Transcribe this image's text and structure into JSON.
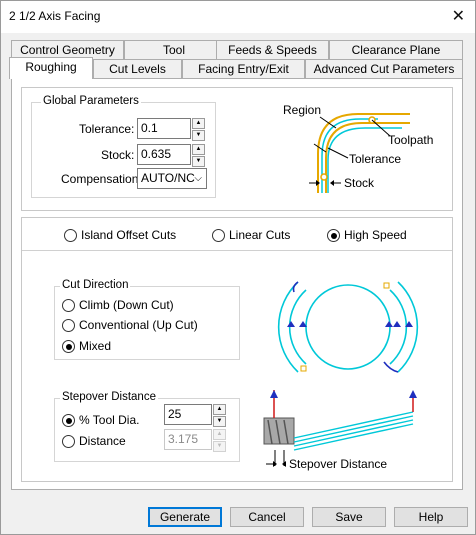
{
  "window": {
    "title": "2 1/2 Axis Facing",
    "close_glyph": "✕"
  },
  "tabs": {
    "row1": [
      "Control Geometry",
      "Tool",
      "Feeds & Speeds",
      "Clearance Plane"
    ],
    "row2": [
      "Roughing",
      "Cut Levels",
      "Facing Entry/Exit",
      "Advanced Cut Parameters"
    ],
    "active": "Roughing"
  },
  "global_params": {
    "legend": "Global Parameters",
    "tolerance_label": "Tolerance:",
    "tolerance_value": "0.1",
    "stock_label": "Stock:",
    "stock_value": "0.635",
    "compensation_label": "Compensation:",
    "compensation_value": "AUTO/NC"
  },
  "diagram_top": {
    "region": "Region",
    "toolpath": "Toolpath",
    "tolerance": "Tolerance",
    "stock": "Stock"
  },
  "cut_pattern": {
    "options": [
      "Island Offset Cuts",
      "Linear Cuts",
      "High Speed"
    ],
    "selected": "High Speed"
  },
  "cut_direction": {
    "legend": "Cut Direction",
    "options": [
      "Climb (Down Cut)",
      "Conventional (Up Cut)",
      "Mixed"
    ],
    "selected": "Mixed"
  },
  "stepover": {
    "legend": "Stepover Distance",
    "tool_dia_label": "% Tool Dia.",
    "tool_dia_value": "25",
    "distance_label": "Distance",
    "distance_value": "3.175",
    "selected": "% Tool Dia."
  },
  "diagram_bottom": {
    "label": "Stepover Distance"
  },
  "buttons": {
    "generate": "Generate",
    "cancel": "Cancel",
    "save": "Save",
    "help": "Help"
  },
  "colors": {
    "cyan": "#00c8d8",
    "gold": "#e6a800",
    "blue": "#1f2fbe",
    "red": "#d01818",
    "accent": "#0078d7"
  }
}
